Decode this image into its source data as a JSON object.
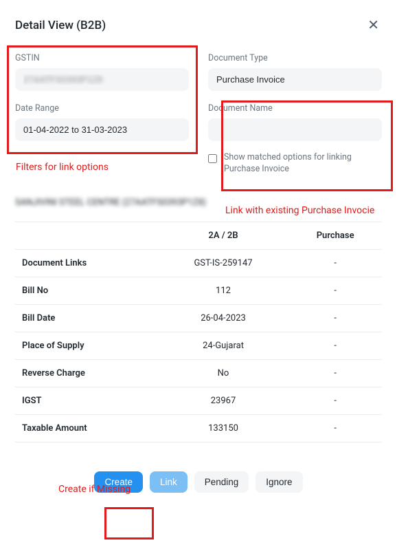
{
  "modal": {
    "title": "Detail View (B2B)"
  },
  "filters": {
    "gstin_label": "GSTIN",
    "gstin_value": "27AATFS0393P1Z8",
    "doctype_label": "Document Type",
    "doctype_value": "Purchase Invoice",
    "daterange_label": "Date Range",
    "daterange_value": "01-04-2022 to 31-03-2023",
    "docname_label": "Document Name",
    "docname_value": "",
    "show_matched_label": "Show matched options for linking Purchase Invoice"
  },
  "annotations": {
    "filters": "Filters for link options",
    "link_existing": "Link with existing Purchase Invocie",
    "create_missing": "Create if Missing"
  },
  "supplier_line": "SANJIVINI STEEL CENTRE (27AATFS0393P1Z8)",
  "table": {
    "headers": {
      "col0": "",
      "col1": "2A / 2B",
      "col2": "Purchase"
    },
    "rows": [
      {
        "label": "Document Links",
        "a": "GST-IS-259147",
        "b": "-"
      },
      {
        "label": "Bill No",
        "a": "112",
        "b": "-"
      },
      {
        "label": "Bill Date",
        "a": "26-04-2023",
        "b": "-"
      },
      {
        "label": "Place of Supply",
        "a": "24-Gujarat",
        "b": "-"
      },
      {
        "label": "Reverse Charge",
        "a": "No",
        "b": "-"
      },
      {
        "label": "IGST",
        "a": "23967",
        "b": "-"
      },
      {
        "label": "Taxable Amount",
        "a": "133150",
        "b": "-"
      }
    ]
  },
  "buttons": {
    "create": "Create",
    "link": "Link",
    "pending": "Pending",
    "ignore": "Ignore"
  }
}
